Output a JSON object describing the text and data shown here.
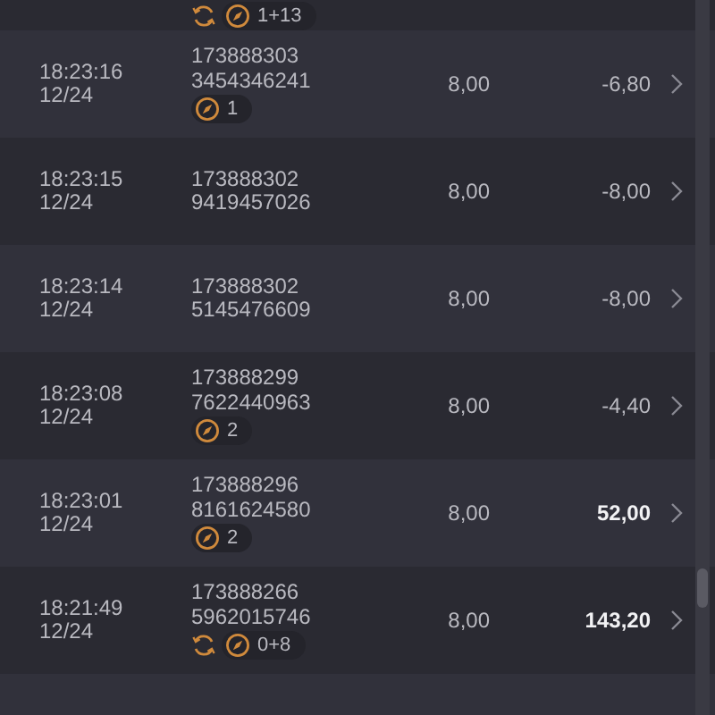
{
  "rows": [
    {
      "badges": [
        {
          "kind": "refresh"
        },
        {
          "kind": "bonus",
          "count": "1+13"
        }
      ]
    },
    {
      "time": "18:23:16",
      "date": "12/24",
      "id_line1": "173888303",
      "id_line2": "3454346241",
      "badges": [
        {
          "kind": "bonus",
          "count": "1"
        }
      ],
      "stake": "8,00",
      "result": "-6,80",
      "win": false
    },
    {
      "time": "18:23:15",
      "date": "12/24",
      "id_line1": "173888302",
      "id_line2": "9419457026",
      "stake": "8,00",
      "result": "-8,00",
      "win": false
    },
    {
      "time": "18:23:14",
      "date": "12/24",
      "id_line1": "173888302",
      "id_line2": "5145476609",
      "stake": "8,00",
      "result": "-8,00",
      "win": false
    },
    {
      "time": "18:23:08",
      "date": "12/24",
      "id_line1": "173888299",
      "id_line2": "7622440963",
      "badges": [
        {
          "kind": "bonus",
          "count": "2"
        }
      ],
      "stake": "8,00",
      "result": "-4,40",
      "win": false
    },
    {
      "time": "18:23:01",
      "date": "12/24",
      "id_line1": "173888296",
      "id_line2": "8161624580",
      "badges": [
        {
          "kind": "bonus",
          "count": "2"
        }
      ],
      "stake": "8,00",
      "result": "52,00",
      "win": true
    },
    {
      "time": "18:21:49",
      "date": "12/24",
      "id_line1": "173888266",
      "id_line2": "5962015746",
      "badges": [
        {
          "kind": "refresh"
        },
        {
          "kind": "bonus",
          "count": "0+8"
        }
      ],
      "stake": "8,00",
      "result": "143,20",
      "win": true
    }
  ]
}
